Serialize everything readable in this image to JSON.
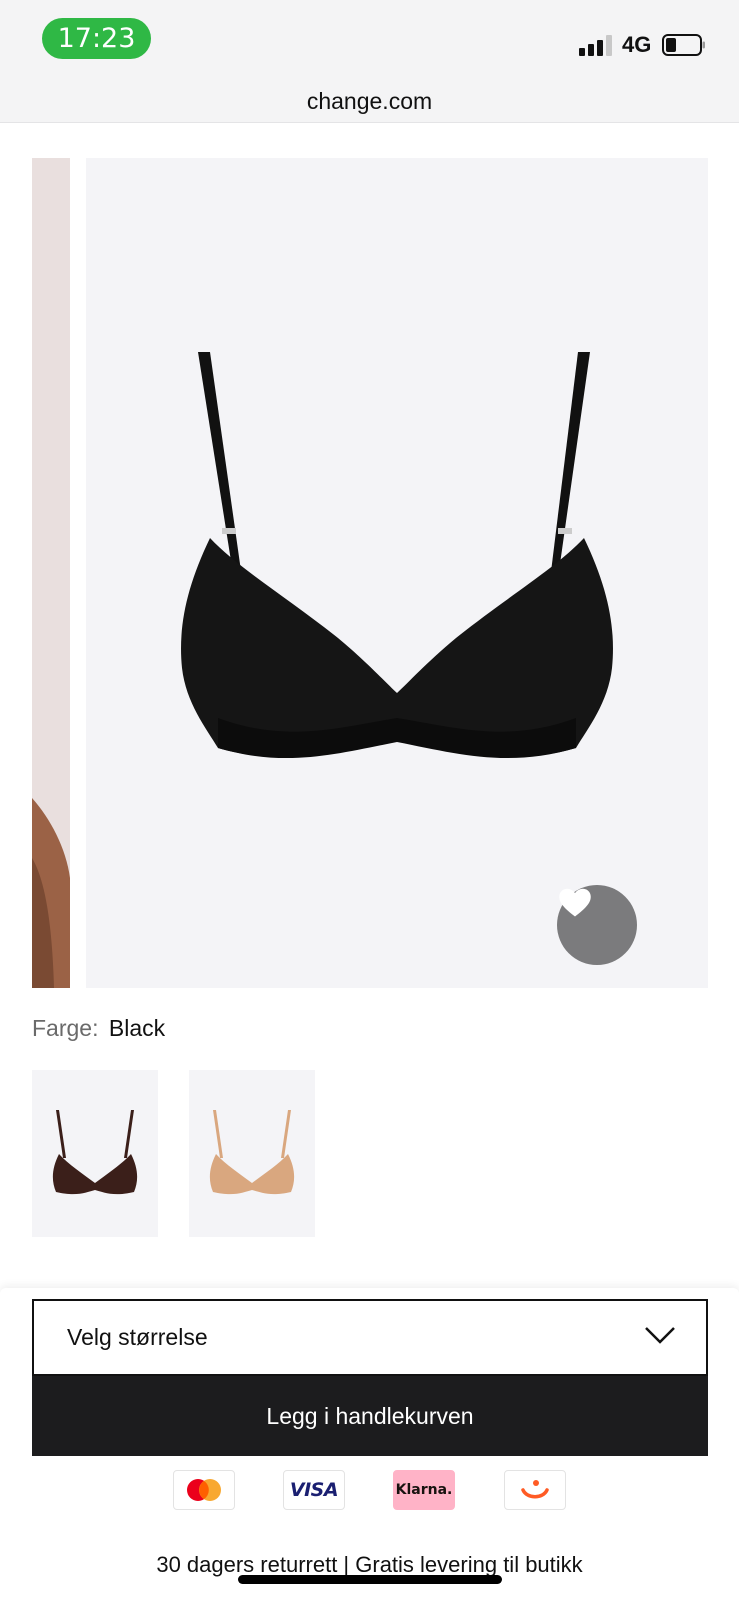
{
  "status_bar": {
    "time": "17:23",
    "network": "4G",
    "signal_icon": "cellular-signal-icon",
    "battery_icon": "battery-low-icon"
  },
  "browser": {
    "url": "change.com"
  },
  "product": {
    "image_alt": "Black wireless bra",
    "favorite_icon": "heart-icon",
    "color_label": "Farge:",
    "color_value": "Black",
    "swatches": [
      {
        "name": "brown-bra-swatch",
        "color": "#3b1f1a"
      },
      {
        "name": "nude-bra-swatch",
        "color": "#d9a77f"
      }
    ]
  },
  "purchase": {
    "size_placeholder": "Velg størrelse",
    "add_to_cart_label": "Legg i handlekurven"
  },
  "payment_methods": {
    "visa_label": "VISA",
    "klarna_label": "Klarna."
  },
  "footer": {
    "info_text": "30 dagers returrett | Gratis levering til butikk"
  },
  "colors": {
    "accent_green": "#2fb845",
    "cart_button_bg": "#1c1c1e",
    "image_bg": "#f4f4f7"
  }
}
